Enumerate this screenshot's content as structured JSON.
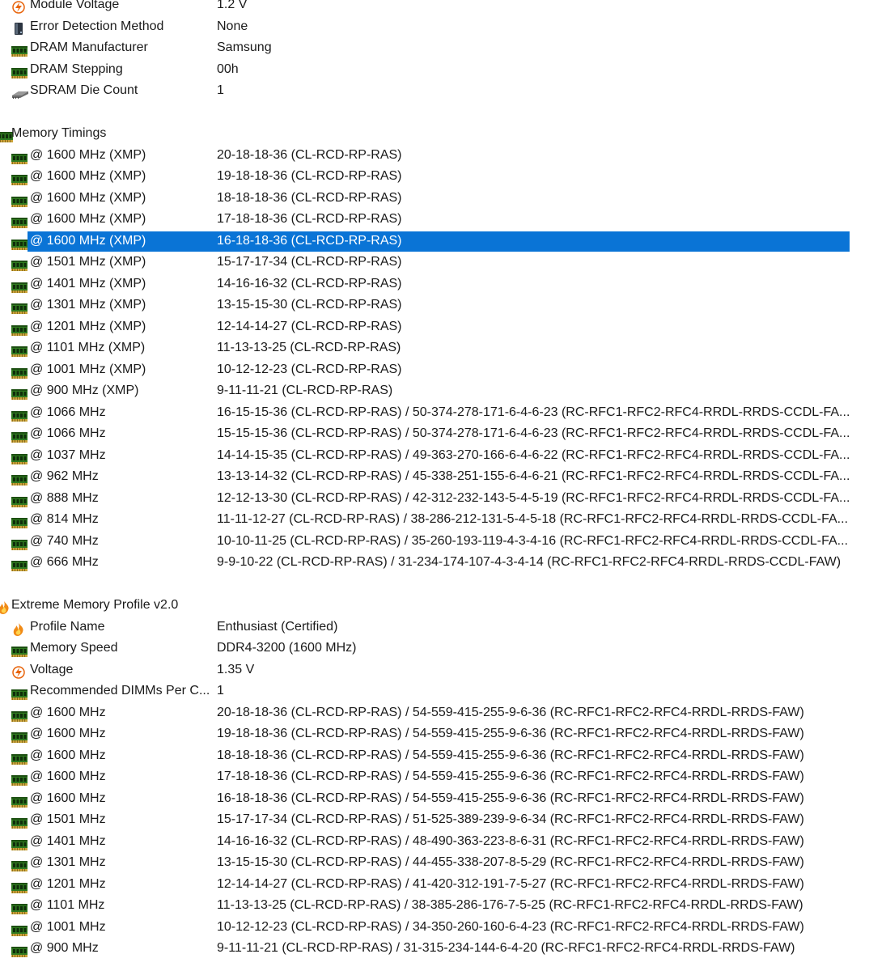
{
  "rows": [
    {
      "type": "item",
      "icon": "bolt-icon",
      "label": "Module Voltage",
      "value": "1.2 V"
    },
    {
      "type": "item",
      "icon": "disk-icon",
      "label": "Error Detection Method",
      "value": "None"
    },
    {
      "type": "item",
      "icon": "ram-icon",
      "label": "DRAM Manufacturer",
      "value": "Samsung"
    },
    {
      "type": "item",
      "icon": "ram-icon",
      "label": "DRAM Stepping",
      "value": "00h"
    },
    {
      "type": "item",
      "icon": "chip-icon",
      "label": "SDRAM Die Count",
      "value": "1"
    },
    {
      "type": "blank"
    },
    {
      "type": "group",
      "icon": "ram-icon",
      "label": "Memory Timings"
    },
    {
      "type": "item",
      "icon": "ram-icon",
      "label": "@ 1600 MHz (XMP)",
      "value": "20-18-18-36  (CL-RCD-RP-RAS)"
    },
    {
      "type": "item",
      "icon": "ram-icon",
      "label": "@ 1600 MHz (XMP)",
      "value": "19-18-18-36  (CL-RCD-RP-RAS)"
    },
    {
      "type": "item",
      "icon": "ram-icon",
      "label": "@ 1600 MHz (XMP)",
      "value": "18-18-18-36  (CL-RCD-RP-RAS)"
    },
    {
      "type": "item",
      "icon": "ram-icon",
      "label": "@ 1600 MHz (XMP)",
      "value": "17-18-18-36  (CL-RCD-RP-RAS)"
    },
    {
      "type": "item",
      "icon": "ram-icon",
      "label": "@ 1600 MHz (XMP)",
      "value": "16-18-18-36  (CL-RCD-RP-RAS)",
      "selected": true
    },
    {
      "type": "item",
      "icon": "ram-icon",
      "label": "@ 1501 MHz (XMP)",
      "value": "15-17-17-34  (CL-RCD-RP-RAS)"
    },
    {
      "type": "item",
      "icon": "ram-icon",
      "label": "@ 1401 MHz (XMP)",
      "value": "14-16-16-32  (CL-RCD-RP-RAS)"
    },
    {
      "type": "item",
      "icon": "ram-icon",
      "label": "@ 1301 MHz (XMP)",
      "value": "13-15-15-30  (CL-RCD-RP-RAS)"
    },
    {
      "type": "item",
      "icon": "ram-icon",
      "label": "@ 1201 MHz (XMP)",
      "value": "12-14-14-27  (CL-RCD-RP-RAS)"
    },
    {
      "type": "item",
      "icon": "ram-icon",
      "label": "@ 1101 MHz (XMP)",
      "value": "11-13-13-25  (CL-RCD-RP-RAS)"
    },
    {
      "type": "item",
      "icon": "ram-icon",
      "label": "@ 1001 MHz (XMP)",
      "value": "10-12-12-23  (CL-RCD-RP-RAS)"
    },
    {
      "type": "item",
      "icon": "ram-icon",
      "label": "@ 900 MHz (XMP)",
      "value": "9-11-11-21  (CL-RCD-RP-RAS)"
    },
    {
      "type": "item",
      "icon": "ram-icon",
      "label": "@ 1066 MHz",
      "value": "16-15-15-36  (CL-RCD-RP-RAS) / 50-374-278-171-6-4-6-23  (RC-RFC1-RFC2-RFC4-RRDL-RRDS-CCDL-FA..."
    },
    {
      "type": "item",
      "icon": "ram-icon",
      "label": "@ 1066 MHz",
      "value": "15-15-15-36  (CL-RCD-RP-RAS) / 50-374-278-171-6-4-6-23  (RC-RFC1-RFC2-RFC4-RRDL-RRDS-CCDL-FA..."
    },
    {
      "type": "item",
      "icon": "ram-icon",
      "label": "@ 1037 MHz",
      "value": "14-14-15-35  (CL-RCD-RP-RAS) / 49-363-270-166-6-4-6-22  (RC-RFC1-RFC2-RFC4-RRDL-RRDS-CCDL-FA..."
    },
    {
      "type": "item",
      "icon": "ram-icon",
      "label": "@ 962 MHz",
      "value": "13-13-14-32  (CL-RCD-RP-RAS) / 45-338-251-155-6-4-6-21  (RC-RFC1-RFC2-RFC4-RRDL-RRDS-CCDL-FA..."
    },
    {
      "type": "item",
      "icon": "ram-icon",
      "label": "@ 888 MHz",
      "value": "12-12-13-30  (CL-RCD-RP-RAS) / 42-312-232-143-5-4-5-19  (RC-RFC1-RFC2-RFC4-RRDL-RRDS-CCDL-FA..."
    },
    {
      "type": "item",
      "icon": "ram-icon",
      "label": "@ 814 MHz",
      "value": "11-11-12-27  (CL-RCD-RP-RAS) / 38-286-212-131-5-4-5-18  (RC-RFC1-RFC2-RFC4-RRDL-RRDS-CCDL-FA..."
    },
    {
      "type": "item",
      "icon": "ram-icon",
      "label": "@ 740 MHz",
      "value": "10-10-11-25  (CL-RCD-RP-RAS) / 35-260-193-119-4-3-4-16  (RC-RFC1-RFC2-RFC4-RRDL-RRDS-CCDL-FA..."
    },
    {
      "type": "item",
      "icon": "ram-icon",
      "label": "@ 666 MHz",
      "value": "9-9-10-22  (CL-RCD-RP-RAS) / 31-234-174-107-4-3-4-14  (RC-RFC1-RFC2-RFC4-RRDL-RRDS-CCDL-FAW)"
    },
    {
      "type": "blank"
    },
    {
      "type": "group",
      "icon": "flame-icon",
      "label": "Extreme Memory Profile v2.0"
    },
    {
      "type": "item",
      "icon": "flame-icon",
      "label": "Profile Name",
      "value": "Enthusiast (Certified)"
    },
    {
      "type": "item",
      "icon": "ram-icon",
      "label": "Memory Speed",
      "value": "DDR4-3200 (1600 MHz)"
    },
    {
      "type": "item",
      "icon": "bolt-icon",
      "label": "Voltage",
      "value": "1.35 V"
    },
    {
      "type": "item",
      "icon": "ram-icon",
      "label": "Recommended DIMMs Per C...",
      "value": "1"
    },
    {
      "type": "item",
      "icon": "ram-icon",
      "label": "@ 1600 MHz",
      "value": "20-18-18-36  (CL-RCD-RP-RAS) / 54-559-415-255-9-6-36  (RC-RFC1-RFC2-RFC4-RRDL-RRDS-FAW)"
    },
    {
      "type": "item",
      "icon": "ram-icon",
      "label": "@ 1600 MHz",
      "value": "19-18-18-36  (CL-RCD-RP-RAS) / 54-559-415-255-9-6-36  (RC-RFC1-RFC2-RFC4-RRDL-RRDS-FAW)"
    },
    {
      "type": "item",
      "icon": "ram-icon",
      "label": "@ 1600 MHz",
      "value": "18-18-18-36  (CL-RCD-RP-RAS) / 54-559-415-255-9-6-36  (RC-RFC1-RFC2-RFC4-RRDL-RRDS-FAW)"
    },
    {
      "type": "item",
      "icon": "ram-icon",
      "label": "@ 1600 MHz",
      "value": "17-18-18-36  (CL-RCD-RP-RAS) / 54-559-415-255-9-6-36  (RC-RFC1-RFC2-RFC4-RRDL-RRDS-FAW)"
    },
    {
      "type": "item",
      "icon": "ram-icon",
      "label": "@ 1600 MHz",
      "value": "16-18-18-36  (CL-RCD-RP-RAS) / 54-559-415-255-9-6-36  (RC-RFC1-RFC2-RFC4-RRDL-RRDS-FAW)"
    },
    {
      "type": "item",
      "icon": "ram-icon",
      "label": "@ 1501 MHz",
      "value": "15-17-17-34  (CL-RCD-RP-RAS) / 51-525-389-239-9-6-34  (RC-RFC1-RFC2-RFC4-RRDL-RRDS-FAW)"
    },
    {
      "type": "item",
      "icon": "ram-icon",
      "label": "@ 1401 MHz",
      "value": "14-16-16-32  (CL-RCD-RP-RAS) / 48-490-363-223-8-6-31  (RC-RFC1-RFC2-RFC4-RRDL-RRDS-FAW)"
    },
    {
      "type": "item",
      "icon": "ram-icon",
      "label": "@ 1301 MHz",
      "value": "13-15-15-30  (CL-RCD-RP-RAS) / 44-455-338-207-8-5-29  (RC-RFC1-RFC2-RFC4-RRDL-RRDS-FAW)"
    },
    {
      "type": "item",
      "icon": "ram-icon",
      "label": "@ 1201 MHz",
      "value": "12-14-14-27  (CL-RCD-RP-RAS) / 41-420-312-191-7-5-27  (RC-RFC1-RFC2-RFC4-RRDL-RRDS-FAW)"
    },
    {
      "type": "item",
      "icon": "ram-icon",
      "label": "@ 1101 MHz",
      "value": "11-13-13-25  (CL-RCD-RP-RAS) / 38-385-286-176-7-5-25  (RC-RFC1-RFC2-RFC4-RRDL-RRDS-FAW)"
    },
    {
      "type": "item",
      "icon": "ram-icon",
      "label": "@ 1001 MHz",
      "value": "10-12-12-23  (CL-RCD-RP-RAS) / 34-350-260-160-6-4-23  (RC-RFC1-RFC2-RFC4-RRDL-RRDS-FAW)"
    },
    {
      "type": "item",
      "icon": "ram-icon",
      "label": "@ 900 MHz",
      "value": "9-11-11-21  (CL-RCD-RP-RAS) / 31-315-234-144-6-4-20  (RC-RFC1-RFC2-RFC4-RRDL-RRDS-FAW)"
    }
  ],
  "colors": {
    "selection": "#0a74d6",
    "ram_green": "#2f7a1f",
    "flame_orange": "#f08a16",
    "bolt_orange": "#e8630a"
  }
}
